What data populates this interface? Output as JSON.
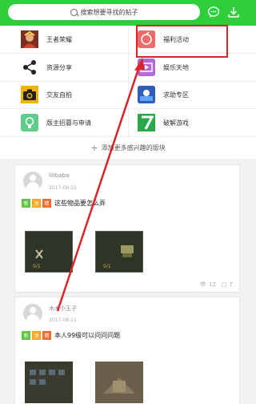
{
  "header": {
    "search_placeholder": "搜索想要寻找的帖子",
    "search_icon": "search-icon",
    "chat_icon": "chat-bubble-icon",
    "download_icon": "download-icon"
  },
  "grid": {
    "left": [
      {
        "label": "王者荣耀",
        "icon": "hero-avatar-icon"
      },
      {
        "label": "资源分享",
        "icon": "share-icon"
      },
      {
        "label": "交友自拍",
        "icon": "camera-icon"
      },
      {
        "label": "版主招募与申请",
        "icon": "lightbulb-icon"
      }
    ],
    "right": [
      {
        "label": "福利活动",
        "icon": "gift-icon"
      },
      {
        "label": "娱乐天地",
        "icon": "film-icon"
      },
      {
        "label": "求助专区",
        "icon": "help-icon"
      },
      {
        "label": "破解游戏",
        "icon": "seven-icon"
      }
    ],
    "add_more": "添加更多感兴趣的版块"
  },
  "posts": [
    {
      "user": "lilibaba",
      "date": "2017-08-15",
      "tags": [
        "新",
        "顶",
        "精"
      ],
      "title": "这些物品要怎么弄",
      "views": "12",
      "comments": "7"
    },
    {
      "user": "木木小王子",
      "date": "2017-08-11",
      "tags": [
        "新",
        "顶",
        "精"
      ],
      "title": "本人99级可以问问问题"
    }
  ],
  "colors": {
    "header": "#2fcf3c",
    "annotation": "#d9262b",
    "tag_new": "#5cc73f",
    "tag_top": "#f5a623",
    "tag_best": "#f26b2d"
  }
}
